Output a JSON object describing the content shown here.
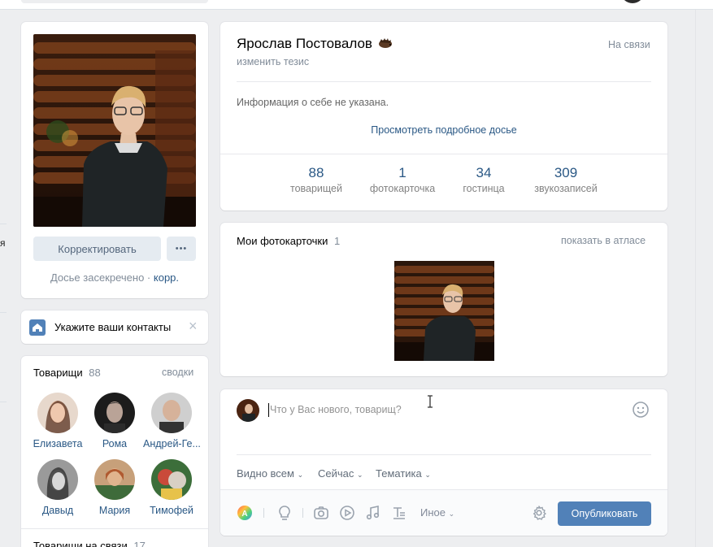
{
  "left_edge": {
    "fragment": "я"
  },
  "profile_photo_card": {
    "edit_button": "Корректировать",
    "more_button": "•••",
    "privacy_text": "Досье засекречено",
    "separator": "·",
    "privacy_link": "корр."
  },
  "contacts_card": {
    "label": "Укажите ваши контакты",
    "close": "×"
  },
  "friends_card": {
    "title": "Товарищи",
    "count": "88",
    "link": "сводки",
    "items": [
      {
        "name": "Елизавета"
      },
      {
        "name": "Рома"
      },
      {
        "name": "Андрей-Ге..."
      },
      {
        "name": "Давыд"
      },
      {
        "name": "Мария"
      },
      {
        "name": "Тимофей"
      }
    ],
    "online_title": "Товарищи на связи",
    "online_count": "17"
  },
  "profile_info": {
    "name": "Ярослав Постовалов",
    "status_action": "изменить тезис",
    "online": "На связи",
    "about": "Информация о себе не указана.",
    "details_link": "Просмотреть подробное досье",
    "stats": [
      {
        "value": "88",
        "label": "товарищей"
      },
      {
        "value": "1",
        "label": "фотокарточка"
      },
      {
        "value": "34",
        "label": "гостинца"
      },
      {
        "value": "309",
        "label": "звукозаписей"
      }
    ]
  },
  "photos_card": {
    "title": "Мои фотокарточки",
    "count": "1",
    "link": "показать в атласе"
  },
  "post_box": {
    "placeholder": "Что у Вас нового, товарищ?",
    "visibility": "Видно всем",
    "time": "Сейчас",
    "topic": "Тематика",
    "more": "Иное",
    "publish": "Опубликовать"
  },
  "colors": {
    "accent": "#5181b8",
    "link": "#2a5885",
    "background": "#edeef0"
  }
}
